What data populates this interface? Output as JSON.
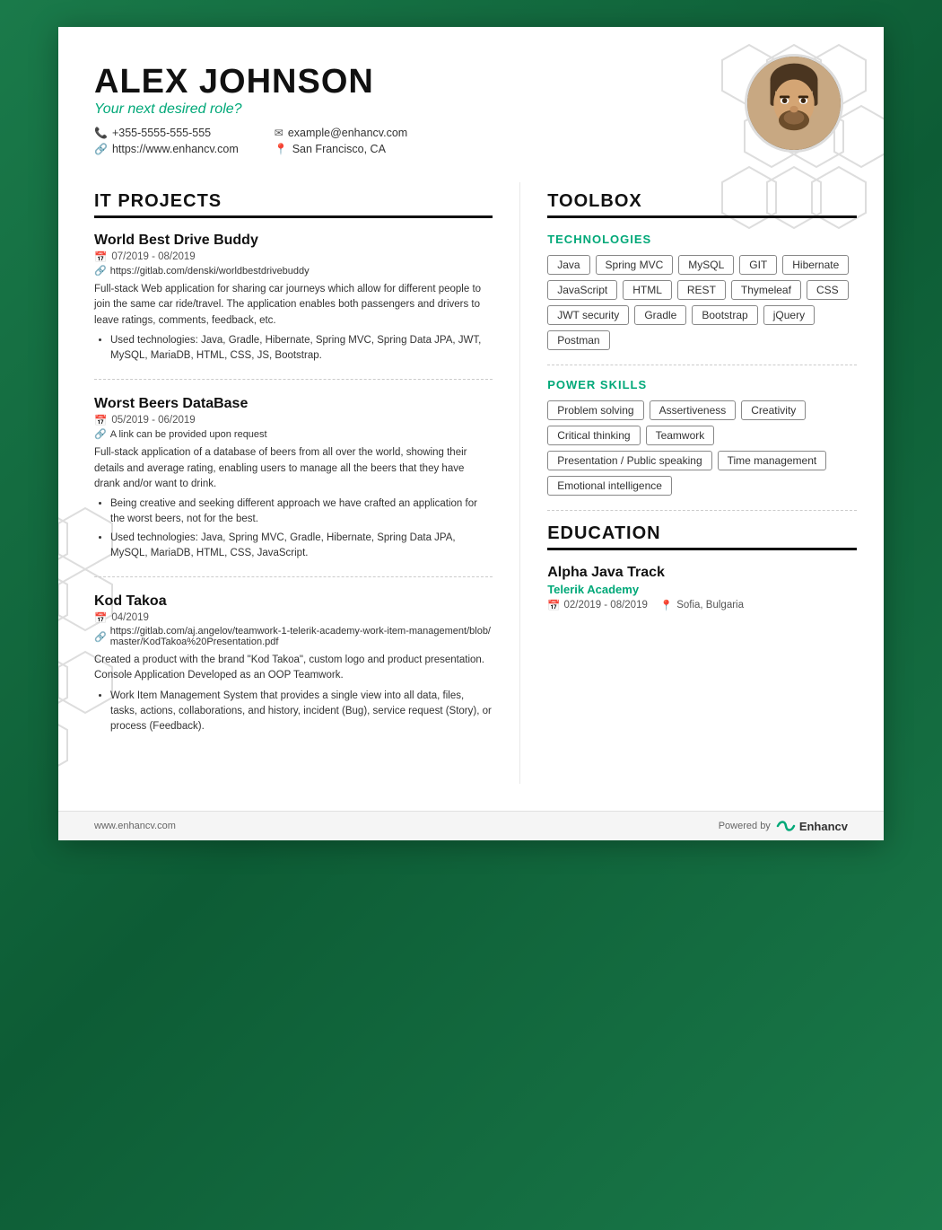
{
  "header": {
    "name": "ALEX JOHNSON",
    "role": "Your next desired role?",
    "phone": "+355-5555-555-555",
    "website": "https://www.enhancv.com",
    "email": "example@enhancv.com",
    "location": "San Francisco, CA"
  },
  "sections": {
    "it_projects_title": "IT PROJECTS",
    "toolbox_title": "TOOLBOX",
    "technologies_title": "TECHNOLOGIES",
    "power_skills_title": "POWER SKILLS",
    "education_title": "EDUCATION"
  },
  "projects": [
    {
      "title": "World Best Drive Buddy",
      "date": "07/2019 - 08/2019",
      "link": "https://gitlab.com/denski/worldbestdrivebuddy",
      "description": "Full-stack Web application for sharing car journeys which allow for different people to join the same car ride/travel. The application enables both passengers and drivers to leave ratings, comments, feedback, etc.",
      "bullets": [
        "Used technologies: Java, Gradle, Hibernate, Spring MVC, Spring Data JPA, JWT, MySQL, MariaDB, HTML, CSS, JS, Bootstrap."
      ]
    },
    {
      "title": "Worst Beers DataBase",
      "date": "05/2019 - 06/2019",
      "link": "A link can be provided upon request",
      "description": "Full-stack application of a database of beers from all over the world, showing their details and average rating, enabling users to manage all the beers that they have drank and/or want to drink.",
      "bullets": [
        "Being creative and seeking different approach we have crafted an application for the worst beers, not for the best.",
        "Used technologies: Java, Spring MVC, Gradle, Hibernate, Spring Data JPA, MySQL, MariaDB, HTML, CSS, JavaScript."
      ]
    },
    {
      "title": "Kod Takoa",
      "date": "04/2019",
      "link": "https://gitlab.com/aj.angelov/teamwork-1-telerik-academy-work-item-management/blob/master/KodTakoa%20Presentation.pdf",
      "description": "Created a product with the brand \"Kod Takoa\", custom logo and product presentation. Console Application Developed as an OOP Teamwork.",
      "bullets": [
        "Work Item Management System that provides a single view into all data, files, tasks, actions, collaborations, and history, incident (Bug), service request (Story), or process (Feedback)."
      ]
    }
  ],
  "technologies": [
    "Java",
    "Spring MVC",
    "MySQL",
    "GIT",
    "Hibernate",
    "JavaScript",
    "HTML",
    "REST",
    "Thymeleaf",
    "CSS",
    "JWT security",
    "Gradle",
    "Bootstrap",
    "jQuery",
    "Postman"
  ],
  "power_skills": [
    "Problem solving",
    "Assertiveness",
    "Creativity",
    "Critical thinking",
    "Teamwork",
    "Presentation / Public speaking",
    "Time management",
    "Emotional intelligence"
  ],
  "education": {
    "degree": "Alpha Java Track",
    "institution": "Telerik Academy",
    "date": "02/2019 - 08/2019",
    "location": "Sofia, Bulgaria"
  },
  "footer": {
    "website": "www.enhancv.com",
    "powered_by": "Powered by",
    "brand": "Enhancv"
  }
}
